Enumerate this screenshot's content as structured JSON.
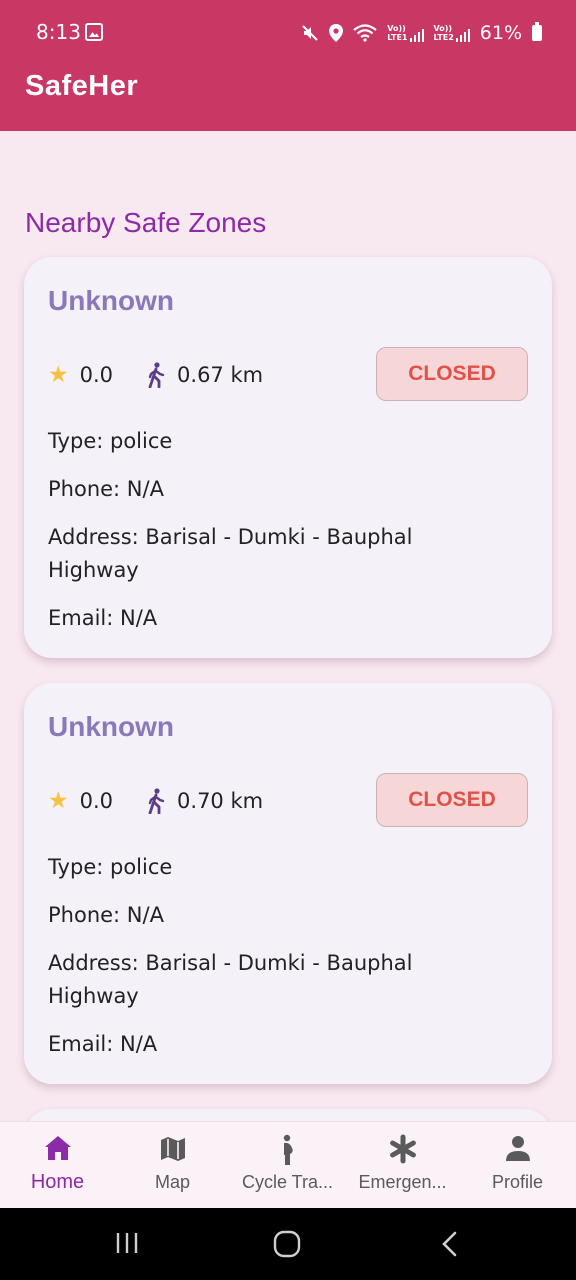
{
  "status_bar": {
    "time": "8:13",
    "lte1": "Vo))\nLTE1",
    "lte2": "Vo))\nLTE2",
    "battery": "61%",
    "icons": [
      "gallery-icon",
      "mute-icon",
      "location-icon",
      "wifi-icon",
      "signal-icon",
      "battery-icon"
    ]
  },
  "app_bar": {
    "title": "SafeHer"
  },
  "main": {
    "section_title": "Nearby Safe Zones",
    "zones": [
      {
        "name": "Unknown",
        "rating": "0.0",
        "distance": "0.67 km",
        "status": "CLOSED",
        "type": "Type: police",
        "phone": "Phone: N/A",
        "address_line1": "Address: Barisal - Dumki - Bauphal",
        "address_line2": "Highway",
        "email": "Email: N/A"
      },
      {
        "name": "Unknown",
        "rating": "0.0",
        "distance": "0.70 km",
        "status": "CLOSED",
        "type": "Type: police",
        "phone": "Phone: N/A",
        "address_line1": "Address: Barisal - Dumki - Bauphal",
        "address_line2": "Highway",
        "email": "Email: N/A"
      }
    ]
  },
  "bottom_nav": {
    "items": [
      {
        "label": "Home",
        "icon": "home-icon",
        "active": true
      },
      {
        "label": "Map",
        "icon": "map-icon",
        "active": false
      },
      {
        "label": "Cycle Tra...",
        "icon": "pregnant-woman-icon",
        "active": false
      },
      {
        "label": "Emergen...",
        "icon": "asterisk-icon",
        "active": false
      },
      {
        "label": "Profile",
        "icon": "person-icon",
        "active": false
      }
    ]
  },
  "colors": {
    "primary": "#c93764",
    "accent_purple": "#8d2aa8",
    "card_title": "#8b78b8",
    "closed_text": "#e05249",
    "closed_bg": "#f7d6d8",
    "background": "#f8e8ef"
  }
}
